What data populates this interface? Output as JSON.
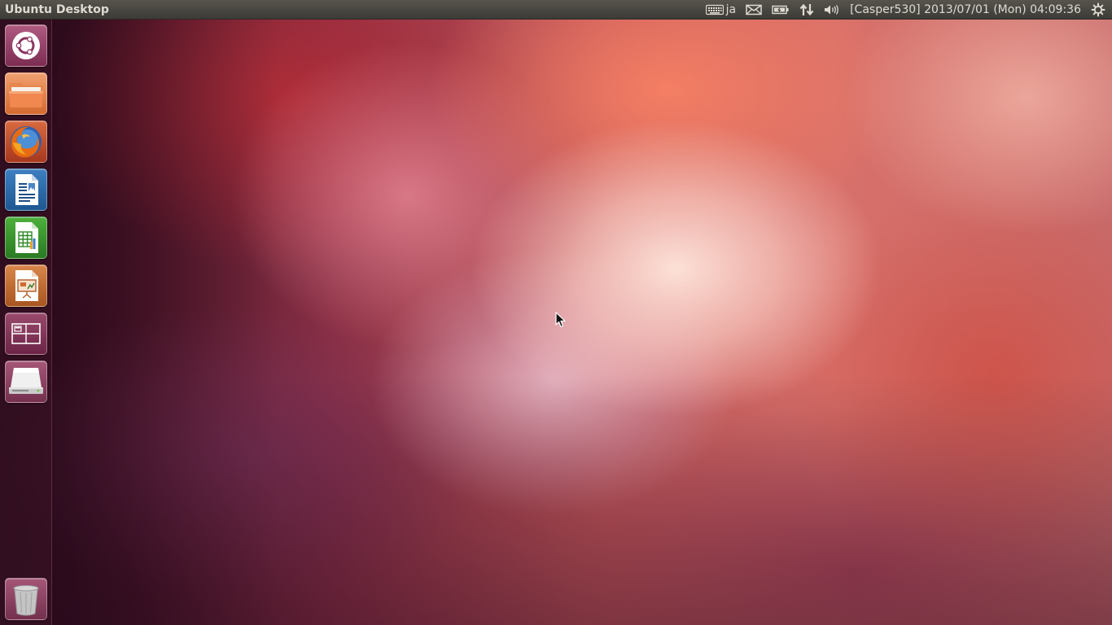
{
  "top_panel": {
    "title": "Ubuntu Desktop",
    "keyboard_layout": "ja",
    "clock": "[Casper530] 2013/07/01 (Mon) 04:09:36",
    "icons": {
      "keyboard": "keyboard-icon",
      "mail": "mail-icon",
      "battery": "battery-icon",
      "network": "network-icon",
      "volume": "volume-icon",
      "session": "gear-icon"
    }
  },
  "launcher": {
    "items": [
      {
        "name": "dash-home",
        "icon": "ubuntu-logo-icon"
      },
      {
        "name": "files",
        "icon": "folder-icon"
      },
      {
        "name": "firefox",
        "icon": "firefox-icon"
      },
      {
        "name": "libreoffice-writer",
        "icon": "writer-icon"
      },
      {
        "name": "libreoffice-calc",
        "icon": "calc-icon"
      },
      {
        "name": "libreoffice-impress",
        "icon": "impress-icon"
      },
      {
        "name": "workspace-switcher",
        "icon": "workspace-icon"
      },
      {
        "name": "removable-drive",
        "icon": "drive-icon"
      },
      {
        "name": "trash",
        "icon": "trash-icon"
      }
    ]
  },
  "colors": {
    "panel_bg": "#3c3b37",
    "panel_text": "#dfdbd2",
    "ubuntu_orange": "#dd4814",
    "launcher_bg": "#3c1426"
  }
}
